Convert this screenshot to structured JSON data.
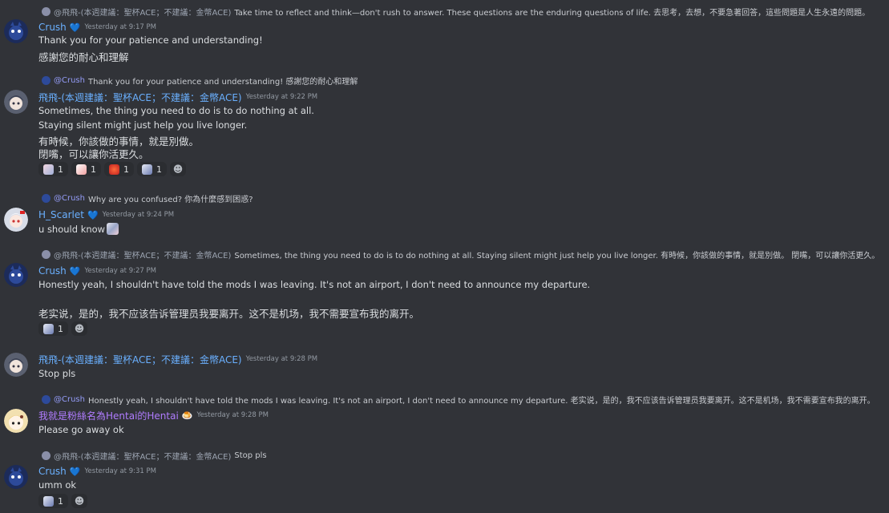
{
  "messages": [
    {
      "reply": {
        "author": "@飛飛-(本週建議：聖杯ACE；不建議：金幣ACE)",
        "text": "Take time to reflect and think—don't rush to answer. These questions are the enduring questions of life. 去思考，去想，不要急著回答，這些問題是人生永遠的問題。"
      },
      "author": "Crush",
      "timestamp": "Yesterday at 9:17 PM",
      "lines": [
        "Thank you for your patience and understanding!",
        "感謝您的耐心和理解"
      ]
    },
    {
      "reply": {
        "author": "@Crush",
        "text": "Thank you for your patience and understanding! 感謝您的耐心和理解"
      },
      "author": "飛飛-(本週建議：聖杯ACE；不建議：金幣ACE)",
      "timestamp": "Yesterday at 9:22 PM",
      "lines": [
        "Sometimes, the thing you need to do is to do nothing at all.",
        "Staying silent might just help you live longer.",
        "有時候，你該做的事情，就是別做。",
        "閉嘴，可以讓你活更久。"
      ],
      "reactions": [
        "1",
        "1",
        "1",
        "1"
      ]
    },
    {
      "reply": {
        "author": "@Crush",
        "text": "Why are you confused? 你為什麼感到困惑?"
      },
      "author": "H_Scarlet",
      "timestamp": "Yesterday at 9:24 PM",
      "lines": [
        "u should know"
      ]
    },
    {
      "reply": {
        "author": "@飛飛-(本週建議：聖杯ACE；不建議：金幣ACE)",
        "text": "Sometimes, the thing you need to do is to do nothing at all. Staying silent might just help you live longer. 有時候，你該做的事情，就是別做。 閉嘴，可以讓你活更久。"
      },
      "author": "Crush",
      "timestamp": "Yesterday at 9:27 PM",
      "lines": [
        "Honestly yeah, I shouldn't have told the mods I was leaving. It's not an airport, I don't need to announce my departure.",
        "老实说，是的，我不应该告诉管理员我要离开。这不是机场，我不需要宣布我的离开。"
      ],
      "reactions": [
        "1"
      ]
    },
    {
      "author": "飛飛-(本週建議：聖杯ACE；不建議：金幣ACE)",
      "timestamp": "Yesterday at 9:28 PM",
      "lines": [
        "Stop pls"
      ]
    },
    {
      "reply": {
        "author": "@Crush",
        "text": "Honestly yeah, I shouldn't have told the mods I was leaving. It's not an airport, I don't need to announce my departure. 老实说，是的，我不应该告诉管理员我要离开。这不是机场，我不需要宣布我的离开。"
      },
      "author": "我就是粉絲名為Hentai的Hentai",
      "timestamp": "Yesterday at 9:28 PM",
      "lines": [
        "Please go away ok"
      ]
    },
    {
      "reply": {
        "author": "@飛飛-(本週建議：聖杯ACE；不建議：金幣ACE)",
        "text": "Stop pls"
      },
      "author": "Crush",
      "timestamp": "Yesterday at 9:31 PM",
      "lines": [
        "umm ok"
      ],
      "reactions": [
        "1"
      ]
    }
  ],
  "colors": {
    "background": "#313338",
    "name_blue": "#6ab0ff",
    "name_purple": "#b07cff",
    "mention": "#949cf7",
    "timestamp": "#949ba4"
  }
}
